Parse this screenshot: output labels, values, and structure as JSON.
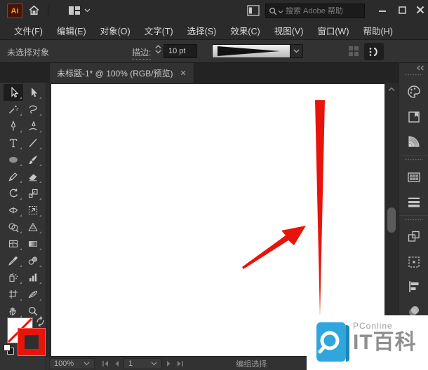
{
  "app": {
    "logo_text": "Ai"
  },
  "titlebar": {
    "search_placeholder": "搜索 Adobe 帮助"
  },
  "menubar": {
    "items": [
      "文件(F)",
      "编辑(E)",
      "对象(O)",
      "文字(T)",
      "选择(S)",
      "效果(C)",
      "视图(V)",
      "窗口(W)",
      "帮助(H)"
    ]
  },
  "control_bar": {
    "no_selection_label": "未选择对象",
    "stroke_label": "描边:",
    "stroke_width_value": "10 pt"
  },
  "tabs": {
    "active_title": "未标题-1* @ 100% (RGB/预览)",
    "close_glyph": "✕"
  },
  "toolbar": {
    "tools": [
      "selection",
      "direct-selection",
      "magic-wand",
      "lasso",
      "pen",
      "curvature",
      "type",
      "line-segment",
      "ellipse",
      "paintbrush",
      "pencil",
      "eraser",
      "rotate",
      "scale",
      "width",
      "free-transform",
      "shape-builder",
      "perspective-grid",
      "mesh",
      "gradient",
      "eyedropper",
      "blend",
      "symbol-sprayer",
      "column-graph",
      "artboard",
      "slice",
      "hand",
      "zoom"
    ]
  },
  "dock": {
    "panels": [
      "color",
      "swatch-book",
      "color-guide",
      "swatches-grid",
      "stroke",
      "transparency",
      "artboards",
      "align",
      "gradient-sphere",
      "layers"
    ]
  },
  "status_bar": {
    "zoom_value": "100%",
    "page_value": "1",
    "mode_label": "编组选择"
  },
  "watermark": {
    "brand": "PConline",
    "title": "IT百科"
  },
  "colors": {
    "accent_red": "#e8140b",
    "watermark_blue": "#2fa7dd",
    "panel_bg": "#323232"
  }
}
